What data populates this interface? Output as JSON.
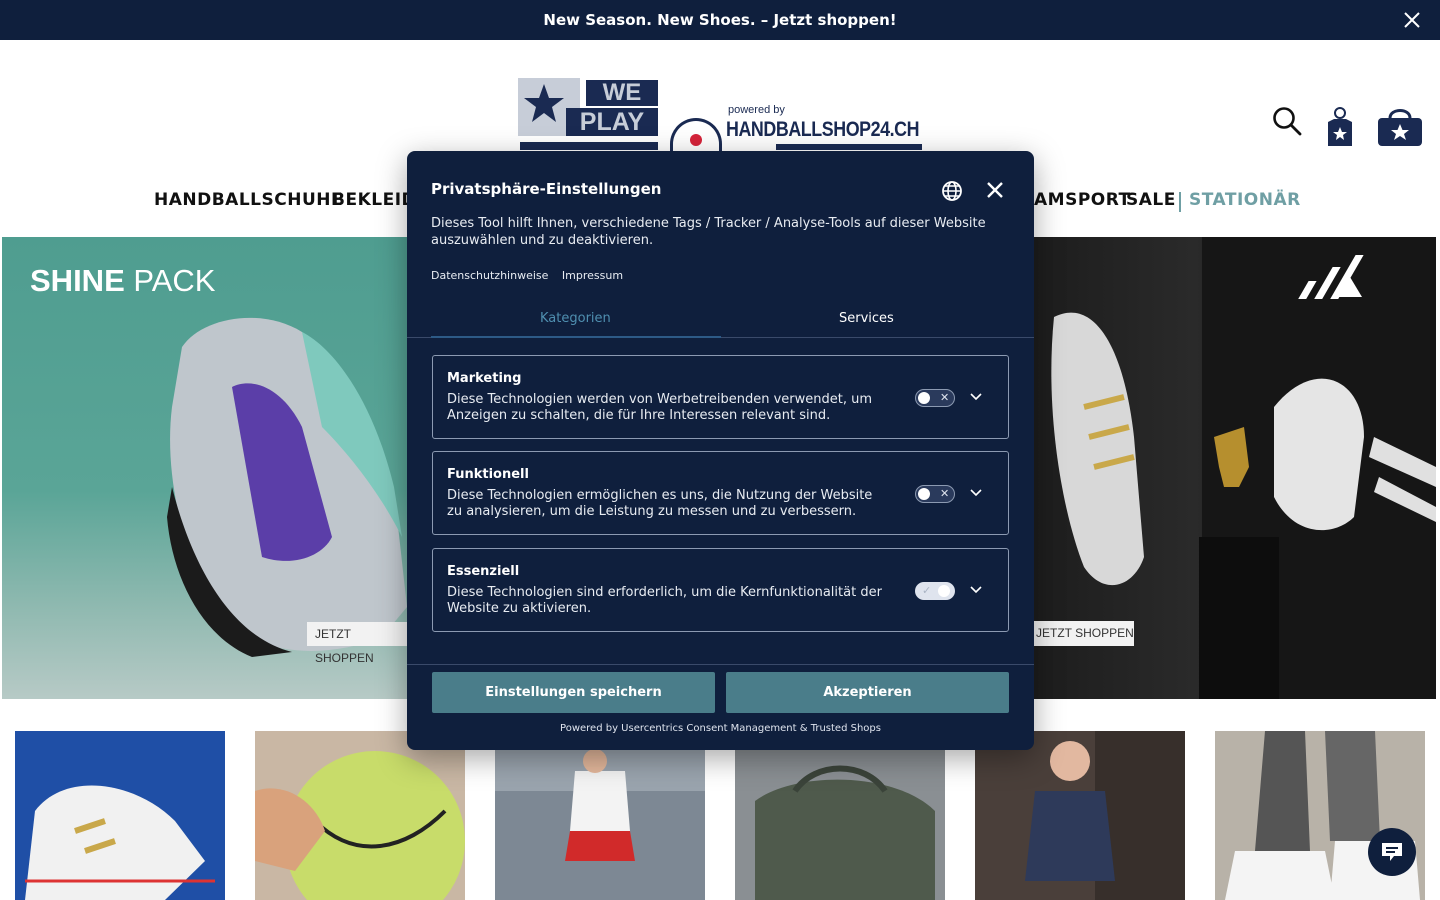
{
  "announcement": {
    "text": "New Season. New Shoes. – Jetzt shoppen!"
  },
  "logo": {
    "we": "WE",
    "play": "PLAY",
    "powered_by": "powered by",
    "shop": "HANDBALLSHOP24.CH"
  },
  "nav": {
    "items": [
      "HANDBALLSCHUHE",
      "BEKLEID",
      "AMSPORT",
      "SALE",
      "STATIONÄR"
    ]
  },
  "hero": {
    "left_title_bold": "SHINE",
    "left_title_rest": " PACK",
    "cta_left": "JETZT SHOPPEN",
    "cta_right": "JETZT SHOPPEN"
  },
  "consent": {
    "title": "Privatsphäre-Einstellungen",
    "description": "Dieses Tool hilft Ihnen, verschiedene Tags / Tracker / Analyse-Tools auf dieser Website auszuwählen und zu deaktivieren.",
    "links": [
      "Datenschutzhinweise",
      "Impressum"
    ],
    "tabs": [
      "Kategorien",
      "Services"
    ],
    "categories": [
      {
        "title": "Marketing",
        "text": "Diese Technologien werden von Werbetreibenden verwendet, um Anzeigen zu schalten, die für Ihre Interessen relevant sind.",
        "enabled": false
      },
      {
        "title": "Funktionell",
        "text": "Diese Technologien ermöglichen es uns, die Nutzung der Website zu analysieren, um die Leistung zu messen und zu verbessern.",
        "enabled": false
      },
      {
        "title": "Essenziell",
        "text": "Diese Technologien sind erforderlich, um die Kernfunktionalität der Website zu aktivieren.",
        "enabled": true
      }
    ],
    "save_label": "Einstellungen speichern",
    "accept_label": "Akzeptieren",
    "powered": "Powered by Usercentrics Consent Management & Trusted Shops"
  },
  "colors": {
    "navy": "#0f1f3d",
    "teal_button": "#4a7d8a",
    "accent_tab": "#4f8fb0",
    "stationar": "#6f9fa4"
  }
}
